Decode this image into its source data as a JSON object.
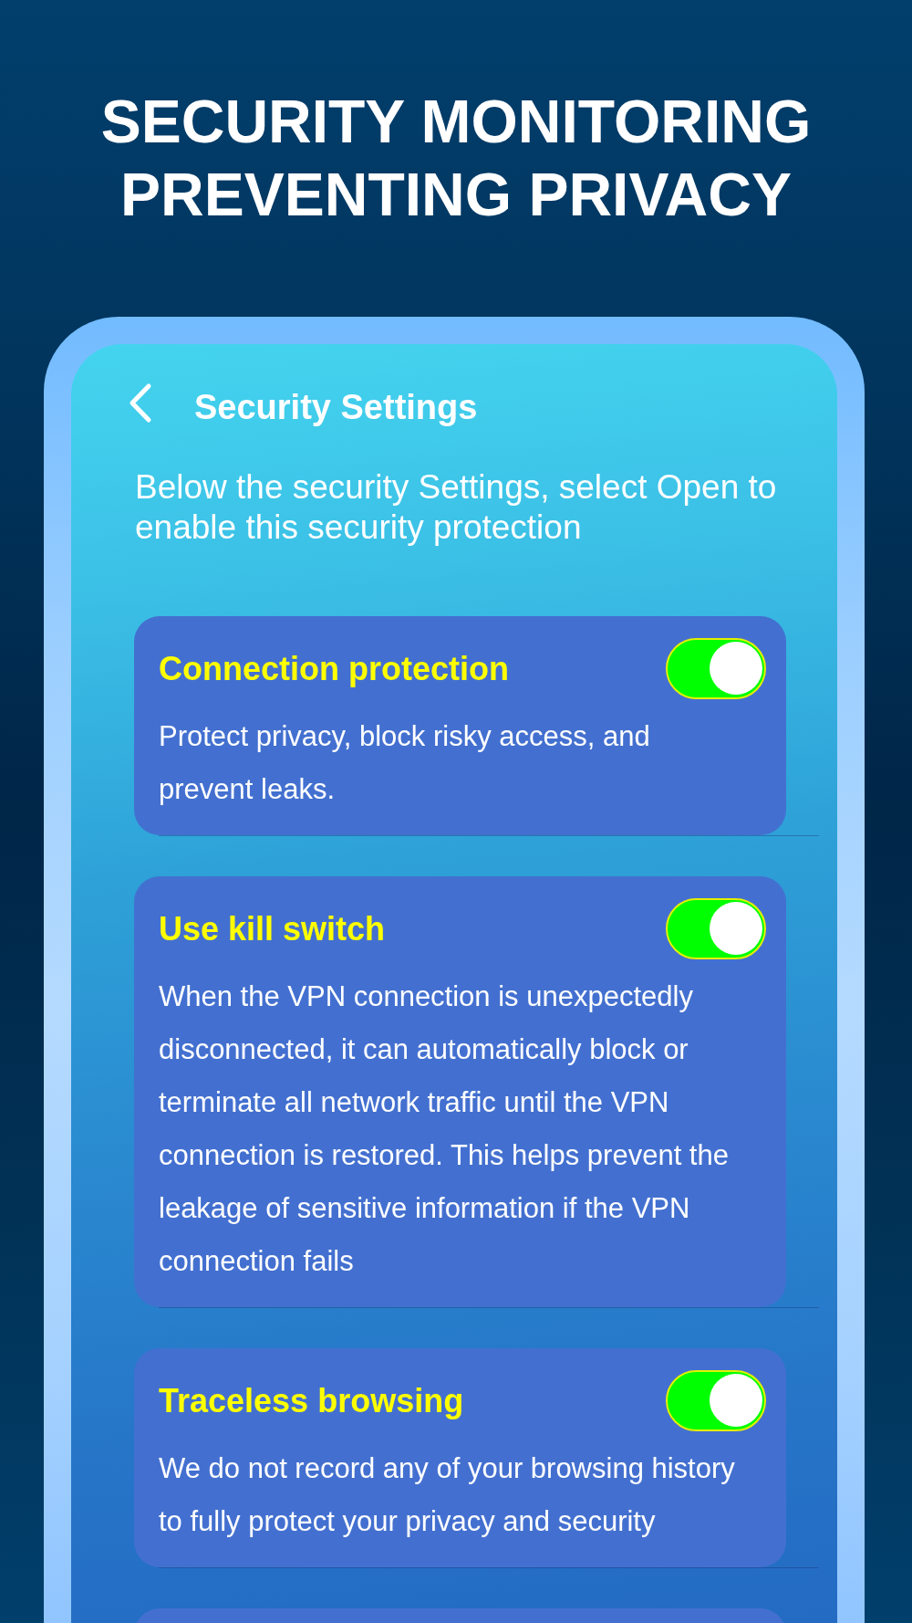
{
  "headline": {
    "lines": [
      "SECURITY MONITORING",
      "PREVENTING PRIVACY"
    ]
  },
  "header": {
    "title": "Security Settings"
  },
  "intro": "Below the security Settings, select Open to enable this security protection",
  "settings": [
    {
      "title": "Connection protection",
      "on": true,
      "description": "Protect privacy, block risky access, and prevent leaks."
    },
    {
      "title": "Use kill switch",
      "on": true,
      "description": "When the VPN connection is unexpectedly disconnected, it can automatically block or terminate all network traffic until the VPN connection is restored. This helps prevent the leakage of sensitive information if the VPN connection fails"
    },
    {
      "title": "Traceless browsing",
      "on": true,
      "description": "We do not record any of your browsing history to fully protect your privacy and security"
    }
  ]
}
